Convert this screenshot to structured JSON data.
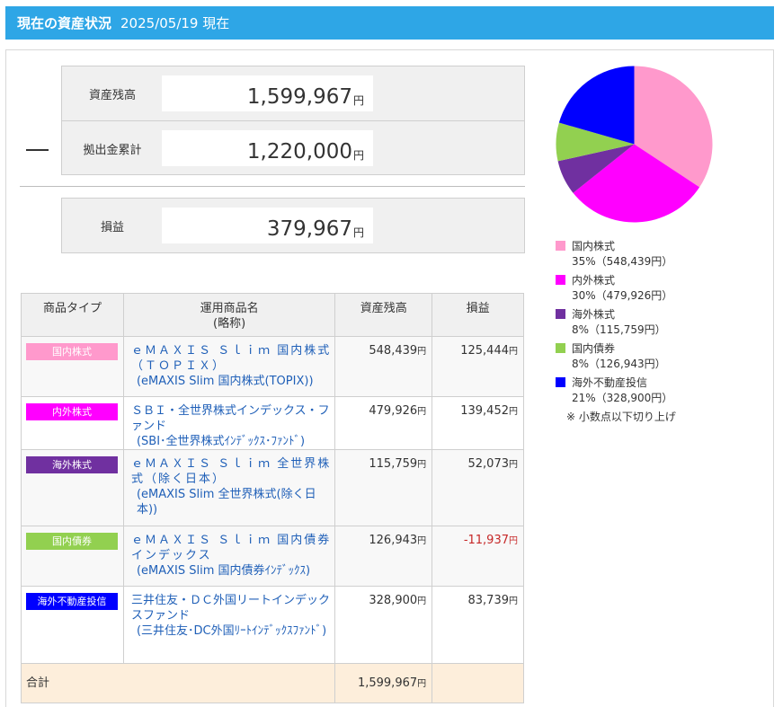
{
  "header": {
    "title": "現在の資産状況",
    "date": "2025/05/19 現在"
  },
  "summary": {
    "balance_label": "資産残高",
    "balance_value": "1,599,967",
    "contribution_label": "拠出金累計",
    "contribution_value": "1,220,000",
    "pnl_label": "損益",
    "pnl_value": "379,967",
    "unit": "円",
    "minus_sign": "—"
  },
  "table": {
    "headers": {
      "type": "商品タイプ",
      "name_line1": "運用商品名",
      "name_line2": "(略称)",
      "balance": "資産残高",
      "pnl": "損益"
    },
    "rows": [
      {
        "type": "国内株式",
        "color": "#ff99cc",
        "name": "ｅＭＡＸＩＳ Ｓｌｉｍ 国内株式（ＴＯＰＩＸ）",
        "abbr": "(eMAXIS Slim 国内株式(TOPIX))",
        "balance": "548,439",
        "pnl": "125,444",
        "pnl_negative": false
      },
      {
        "type": "内外株式",
        "color": "#ff00ff",
        "name": "ＳＢＩ・全世界株式インデックス・ファンド",
        "abbr": "(SBI･全世界株式ｲﾝﾃﾞｯｸｽ･ﾌｧﾝﾄﾞ)",
        "balance": "479,926",
        "pnl": "139,452",
        "pnl_negative": false
      },
      {
        "type": "海外株式",
        "color": "#7030a0",
        "name": "ｅＭＡＸＩＳ Ｓｌｉｍ 全世界株式（除く日本）",
        "abbr": "(eMAXIS Slim 全世界株式(除く日本))",
        "balance": "115,759",
        "pnl": "52,073",
        "pnl_negative": false
      },
      {
        "type": "国内債券",
        "color": "#92d050",
        "name": "ｅＭＡＸＩＳ Ｓｌｉｍ 国内債券インデックス",
        "abbr": "(eMAXIS Slim 国内債券ｲﾝﾃﾞｯｸｽ)",
        "balance": "126,943",
        "pnl": "-11,937",
        "pnl_negative": true
      },
      {
        "type": "海外不動産投信",
        "color": "#0000ff",
        "name": "三井住友・ＤＣ外国リートインデックスファンド",
        "abbr": "(三井住友･DC外国ﾘｰﾄｲﾝﾃﾞｯｸｽﾌｧﾝﾄﾞ)",
        "balance": "328,900",
        "pnl": "83,739",
        "pnl_negative": false
      }
    ],
    "total_label": "合計",
    "total_balance": "1,599,967",
    "unit": "円"
  },
  "chart_data": {
    "type": "pie",
    "slices": [
      {
        "label": "国内株式",
        "percent_label": "35%（548,439円）",
        "value": 548439,
        "color": "#ff99cc"
      },
      {
        "label": "内外株式",
        "percent_label": "30%（479,926円）",
        "value": 479926,
        "color": "#ff00ff"
      },
      {
        "label": "海外株式",
        "percent_label": "8%（115,759円）",
        "value": 115759,
        "color": "#7030a0"
      },
      {
        "label": "国内債券",
        "percent_label": "8%（126,943円）",
        "value": 126943,
        "color": "#92d050"
      },
      {
        "label": "海外不動産投信",
        "percent_label": "21%（328,900円）",
        "value": 328900,
        "color": "#0000ff"
      }
    ],
    "note": "※ 小数点以下切り上げ"
  }
}
